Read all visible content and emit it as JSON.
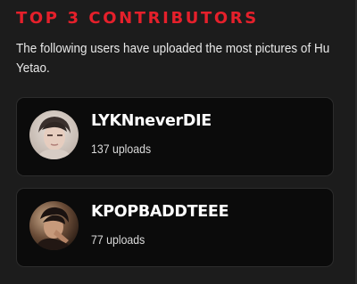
{
  "section": {
    "title": "TOP 3 CONTRIBUTORS",
    "description": "The following users have uploaded the most pictures of Hu Yetao."
  },
  "contributors": [
    {
      "username": "LYKNneverDIE",
      "uploads": "137 uploads",
      "avatar_icon": "user-avatar-photo"
    },
    {
      "username": "KPOPBADDTEEE",
      "uploads": "77 uploads",
      "avatar_icon": "user-avatar-photo"
    }
  ],
  "colors": {
    "accent": "#e5202b",
    "panel_bg": "#1c1c1c",
    "card_bg": "#0b0b0b",
    "card_border": "#2c2c2c"
  }
}
